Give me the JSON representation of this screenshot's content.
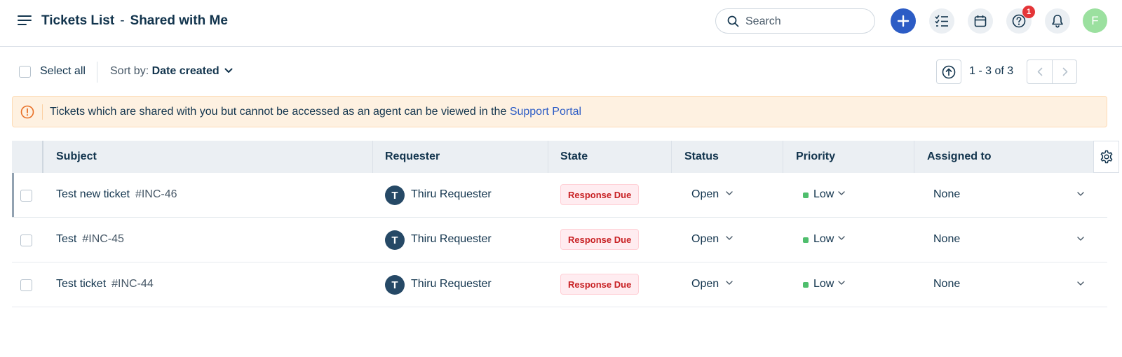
{
  "header": {
    "title": "Tickets List",
    "separator": "-",
    "view_name": "Shared with Me",
    "search": {
      "placeholder": "Search"
    },
    "notification_badge": "1",
    "avatar_initial": "F"
  },
  "toolbar": {
    "select_all_label": "Select all",
    "sort_prefix": "Sort by:",
    "sort_value": "Date created",
    "page_info": "1 - 3 of 3"
  },
  "banner": {
    "text": "Tickets which are shared with you but cannot be accessed as an agent can be viewed in the",
    "link": "Support Portal"
  },
  "table": {
    "columns": [
      "Subject",
      "Requester",
      "State",
      "Status",
      "Priority",
      "Assigned to"
    ],
    "rows": [
      {
        "subject": "Test new ticket",
        "id": "#INC-46",
        "requester_initial": "T",
        "requester": "Thiru Requester",
        "state": "Response Due",
        "status": "Open",
        "priority": "Low",
        "assigned_to": "None"
      },
      {
        "subject": "Test",
        "id": "#INC-45",
        "requester_initial": "T",
        "requester": "Thiru Requester",
        "state": "Response Due",
        "status": "Open",
        "priority": "Low",
        "assigned_to": "None"
      },
      {
        "subject": "Test ticket",
        "id": "#INC-44",
        "requester_initial": "T",
        "requester": "Thiru Requester",
        "state": "Response Due",
        "status": "Open",
        "priority": "Low",
        "assigned_to": "None"
      }
    ]
  },
  "colors": {
    "primary": "#2c5cc5",
    "text": "#12344d",
    "banner_bg": "#fef1e1",
    "warning": "#e86f25",
    "state_text": "#c82124",
    "priority_low": "#4fbe6d",
    "badge": "#e43538",
    "avatar": "#9be09f"
  },
  "icons": [
    "menu-icon",
    "search-icon",
    "plus-icon",
    "tasks-icon",
    "calendar-icon",
    "help-icon",
    "bell-icon",
    "arrow-up-icon",
    "chevron-left-icon",
    "chevron-right-icon",
    "warning-icon",
    "gear-icon",
    "chevron-down-icon"
  ]
}
